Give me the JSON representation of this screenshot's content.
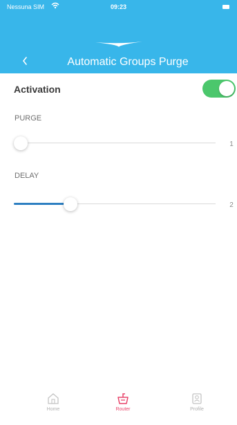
{
  "status_bar": {
    "carrier": "Nessuna SIM",
    "time": "09:23"
  },
  "header": {
    "title": "Automatic Groups Purge"
  },
  "activation": {
    "label": "Activation",
    "enabled": true
  },
  "purge": {
    "label": "PURGE",
    "value": "1",
    "fill_fraction": 0.0
  },
  "delay": {
    "label": "DELAY",
    "value": "2",
    "fill_fraction": 0.28
  },
  "tabbar": {
    "active_tab": 1,
    "tabs": [
      {
        "label": "Home",
        "icon": "home-icon"
      },
      {
        "label": "Router",
        "icon": "router-icon"
      },
      {
        "label": "Profile",
        "icon": "profile-icon"
      }
    ]
  },
  "colors": {
    "header": "#38b6ea",
    "toggle_on": "#4bc76c",
    "slider_fill": "#2d7fc1",
    "active_tab": "#e8456b"
  }
}
